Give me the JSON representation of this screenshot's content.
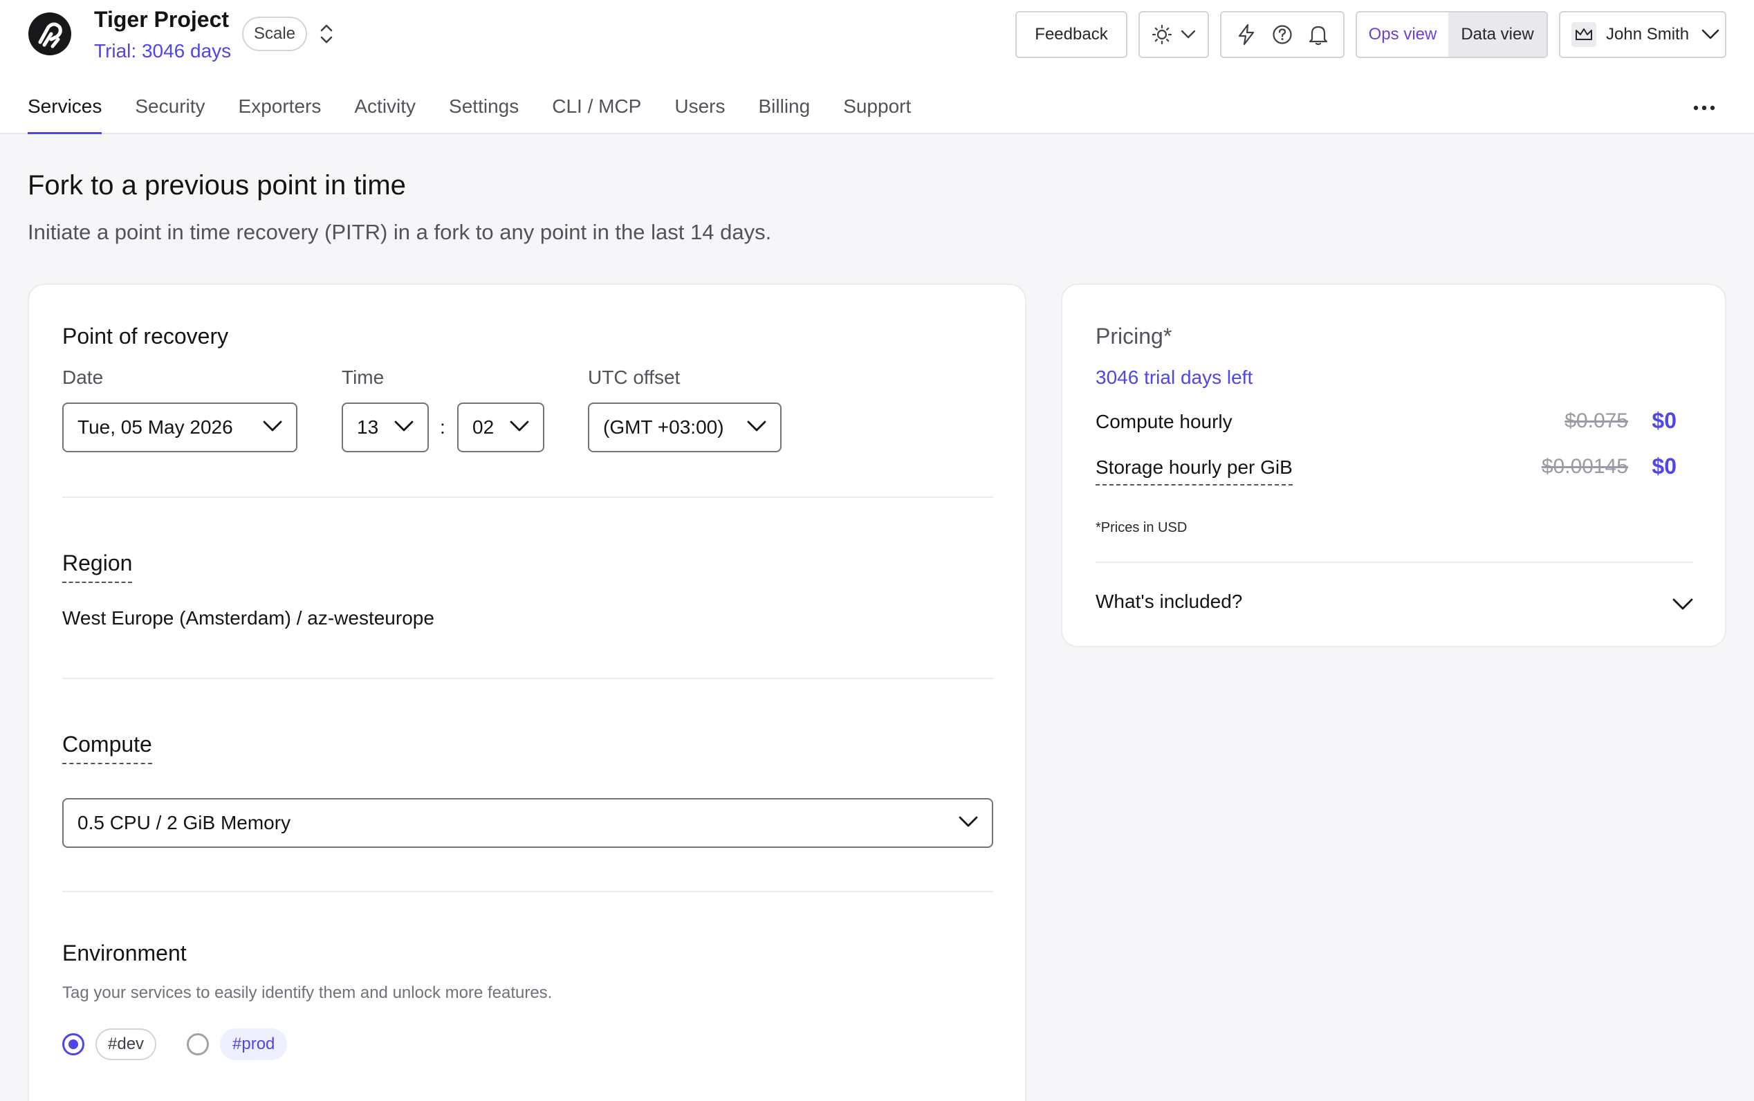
{
  "header": {
    "project_name": "Tiger Project",
    "trial_text": "Trial: 3046 days",
    "plan_badge": "Scale",
    "feedback_label": "Feedback",
    "view_toggle": {
      "ops": "Ops view",
      "data": "Data view",
      "active": "Ops view"
    },
    "user_name": "John Smith",
    "icons": [
      "logo-icon",
      "switch-project-icon",
      "sun-icon",
      "chevron-down-icon",
      "lightning-icon",
      "help-icon",
      "bell-icon",
      "crown-icon",
      "more-icon"
    ]
  },
  "nav": {
    "tabs": [
      {
        "label": "Services",
        "active": true
      },
      {
        "label": "Security"
      },
      {
        "label": "Exporters"
      },
      {
        "label": "Activity"
      },
      {
        "label": "Settings"
      },
      {
        "label": "CLI / MCP"
      },
      {
        "label": "Users"
      },
      {
        "label": "Billing"
      },
      {
        "label": "Support"
      }
    ]
  },
  "page": {
    "title": "Fork to a previous point in time",
    "subtitle": "Initiate a point in time recovery (PITR) in a fork to any point in the last 14 days."
  },
  "recovery": {
    "title": "Point of recovery",
    "date_label": "Date",
    "date_value": "Tue, 05 May 2026",
    "time_label": "Time",
    "hour_value": "13",
    "colon": ":",
    "minute_value": "02",
    "utc_label": "UTC offset",
    "utc_value": "(GMT +03:00)"
  },
  "region": {
    "title": "Region",
    "value": "West Europe (Amsterdam) / az-westeurope"
  },
  "compute": {
    "title": "Compute",
    "value": "0.5 CPU / 2 GiB Memory"
  },
  "environment": {
    "title": "Environment",
    "description": "Tag your services to easily identify them and unlock more features.",
    "options": [
      {
        "label": "#dev",
        "selected": true
      },
      {
        "label": "#prod",
        "selected": false
      }
    ]
  },
  "pricing": {
    "title": "Pricing*",
    "trial_left": "3046 trial days left",
    "rows": [
      {
        "label": "Compute hourly",
        "old_price": "$0.075",
        "new_price": "$0"
      },
      {
        "label": "Storage hourly per GiB",
        "old_price": "$0.00145",
        "new_price": "$0"
      }
    ],
    "note": "*Prices in USD",
    "included_label": "What's included?"
  },
  "colors": {
    "accent": "#4f46e5",
    "ops_view": "#6d3fe0",
    "background": "#f6f6f8"
  }
}
